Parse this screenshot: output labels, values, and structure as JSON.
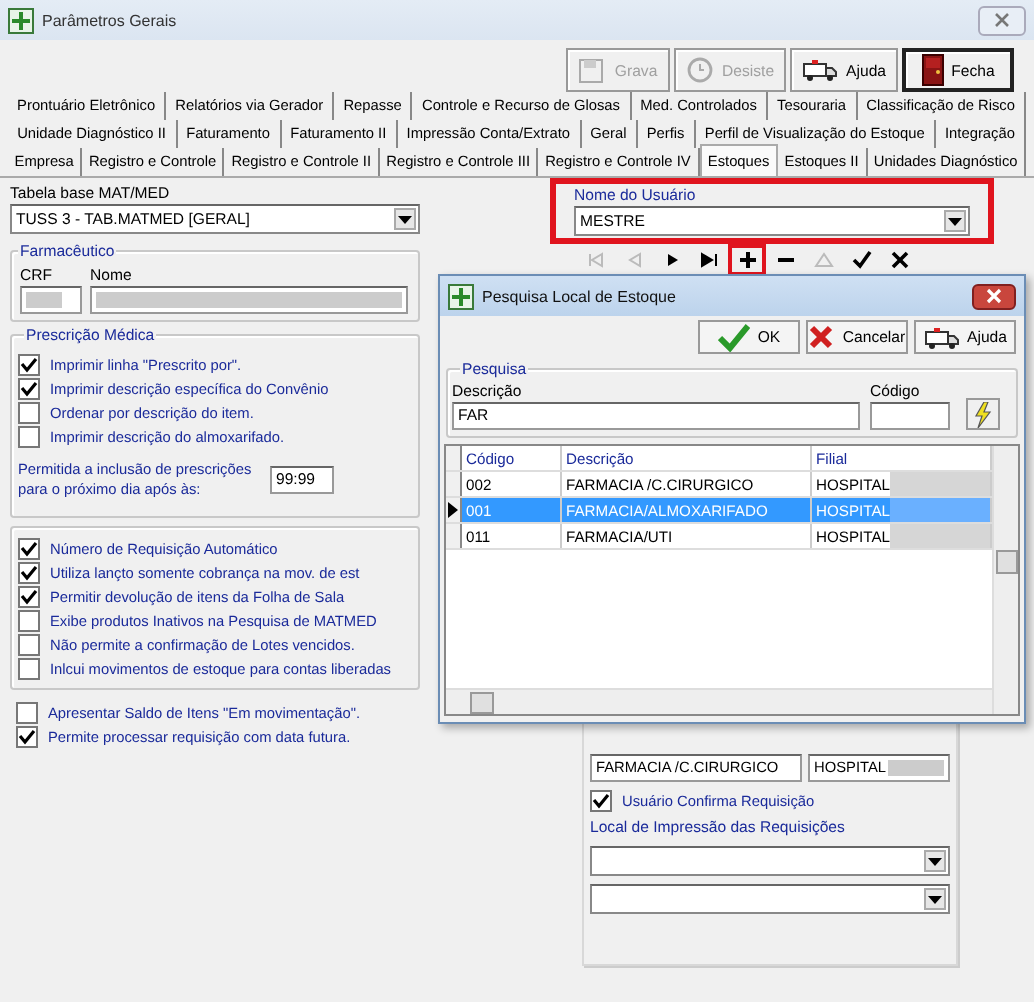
{
  "window": {
    "title": "Parâmetros Gerais"
  },
  "toolbar": [
    {
      "label": "Grava",
      "disabled": true
    },
    {
      "label": "Desiste",
      "disabled": true
    },
    {
      "label": "Ajuda",
      "disabled": false
    },
    {
      "label": "Fecha",
      "disabled": false
    }
  ],
  "tab_rows": [
    [
      {
        "label": "Prontuário Eletrônico",
        "selected": false
      },
      {
        "label": "Relatórios via Gerador",
        "selected": false
      },
      {
        "label": "Repasse",
        "selected": false
      },
      {
        "label": "Controle e Recurso de Glosas",
        "selected": false
      },
      {
        "label": "Med. Controlados",
        "selected": false
      },
      {
        "label": "Tesouraria",
        "selected": false
      },
      {
        "label": "Classificação de Risco",
        "selected": false
      }
    ],
    [
      {
        "label": "Unidade Diagnóstico II",
        "selected": false
      },
      {
        "label": "Faturamento",
        "selected": false
      },
      {
        "label": "Faturamento II",
        "selected": false
      },
      {
        "label": "Impressão Conta/Extrato",
        "selected": false
      },
      {
        "label": "Geral",
        "selected": false
      },
      {
        "label": "Perfis",
        "selected": false
      },
      {
        "label": "Perfil de Visualização do Estoque",
        "selected": false
      },
      {
        "label": "Integração",
        "selected": false
      }
    ],
    [
      {
        "label": "Empresa",
        "selected": false
      },
      {
        "label": "Registro e Controle",
        "selected": false
      },
      {
        "label": "Registro e Controle II",
        "selected": false
      },
      {
        "label": "Registro e Controle III",
        "selected": false
      },
      {
        "label": "Registro e Controle IV",
        "selected": false
      },
      {
        "label": "Estoques",
        "selected": true
      },
      {
        "label": "Estoques II",
        "selected": false
      },
      {
        "label": "Unidades Diagnóstico",
        "selected": false
      }
    ]
  ],
  "tabela_base": {
    "label": "Tabela base MAT/MED",
    "value": "TUSS 3 - TAB.MATMED [GERAL]"
  },
  "farmaceutico": {
    "title": "Farmacêutico",
    "crf_label": "CRF",
    "nome_label": "Nome"
  },
  "prescricao": {
    "title": "Prescrição Médica",
    "options": [
      {
        "label": "Imprimir linha \"Prescrito por\".",
        "checked": true
      },
      {
        "label": "Imprimir descrição específica do Convênio",
        "checked": true
      },
      {
        "label": "Ordenar por descrição do item.",
        "checked": false
      },
      {
        "label": "Imprimir descrição do almoxarifado.",
        "checked": false
      }
    ],
    "time_label": "Permitida a inclusão de prescrições para o próximo dia após às:",
    "time_value": "99:99"
  },
  "requisicao_options": [
    {
      "label": "Número de Requisição Automático",
      "checked": true
    },
    {
      "label": "Utiliza lançto somente cobrança na mov. de est",
      "checked": true
    },
    {
      "label": "Permitir devolução de itens da Folha de Sala",
      "checked": true
    },
    {
      "label": "Exibe produtos Inativos na Pesquisa de MATMED",
      "checked": false
    },
    {
      "label": "Não permite a confirmação de Lotes vencidos.",
      "checked": false
    },
    {
      "label": "Inlcui movimentos de estoque para contas liberadas",
      "checked": false
    }
  ],
  "extra_options": [
    {
      "label": "Apresentar Saldo de Itens \"Em movimentação\".",
      "checked": false
    },
    {
      "label": "Permite processar requisição com data futura.",
      "checked": true
    }
  ],
  "usuario": {
    "label": "Nome do Usuário",
    "value": "MESTRE",
    "highlighted": true
  },
  "navigator": [
    {
      "kind": "first",
      "disabled": true,
      "highlighted": false
    },
    {
      "kind": "prior",
      "disabled": true,
      "highlighted": false
    },
    {
      "kind": "next",
      "disabled": false,
      "highlighted": false
    },
    {
      "kind": "last",
      "disabled": false,
      "highlighted": false
    },
    {
      "kind": "insert",
      "disabled": false,
      "highlighted": true
    },
    {
      "kind": "delete",
      "disabled": false,
      "highlighted": false
    },
    {
      "kind": "edit",
      "disabled": true,
      "highlighted": false
    },
    {
      "kind": "post",
      "disabled": false,
      "highlighted": false
    },
    {
      "kind": "cancel",
      "disabled": false,
      "highlighted": false
    }
  ],
  "local_estoque": {
    "local_value": "FARMACIA /C.CIRURGICO",
    "filial_value": "HOSPITAL"
  },
  "confirma": {
    "label": "Usuário Confirma Requisição",
    "checked": true
  },
  "impressao": {
    "label": "Local de Impressão das Requisições"
  },
  "dialog": {
    "title": "Pesquisa Local de Estoque",
    "buttons": [
      {
        "label": "OK"
      },
      {
        "label": "Cancelar"
      },
      {
        "label": "Ajuda"
      }
    ],
    "search": {
      "title": "Pesquisa",
      "descricao_label": "Descrição",
      "descricao_value": "FAR",
      "codigo_label": "Código"
    },
    "columns": [
      "Código",
      "Descrição",
      "Filial"
    ],
    "rows": [
      {
        "codigo": "002",
        "descricao": "FARMACIA /C.CIRURGICO",
        "filial": "HOSPITAL",
        "selected": false
      },
      {
        "codigo": "001",
        "descricao": "FARMACIA/ALMOXARIFADO",
        "filial": "HOSPITAL",
        "selected": true
      },
      {
        "codigo": "011",
        "descricao": "FARMACIA/UTI",
        "filial": "HOSPITAL",
        "selected": false
      }
    ]
  }
}
